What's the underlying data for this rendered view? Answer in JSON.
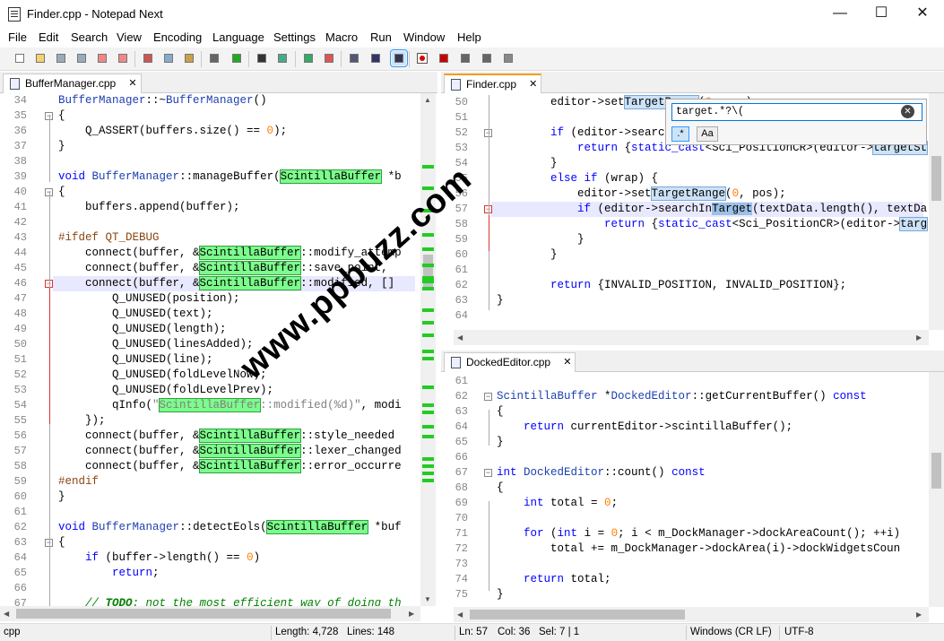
{
  "window": {
    "title": "Finder.cpp - Notepad Next",
    "minimize": "—",
    "maximize": "☐",
    "close": "✕"
  },
  "menu": [
    "File",
    "Edit",
    "Search",
    "View",
    "Encoding",
    "Language",
    "Settings",
    "Macro",
    "Run",
    "Window",
    "Help"
  ],
  "toolbar_icons": [
    "new-file-icon",
    "open-file-icon",
    "save-icon",
    "save-all-icon",
    "close-icon",
    "close-all-icon",
    "cut-icon",
    "copy-icon",
    "paste-icon",
    "undo-icon",
    "redo-icon",
    "find-icon",
    "replace-icon",
    "zoom-in-icon",
    "zoom-out-icon",
    "word-wrap-icon",
    "show-all-chars-icon",
    "indent-guide-icon",
    "record-macro-icon",
    "stop-record-icon",
    "play-macro-icon",
    "run-macro-multiple-icon",
    "save-macro-icon"
  ],
  "left_panel": {
    "tab": "BufferManager.cpp",
    "lines": [
      {
        "n": "34",
        "t": "<span class='ty'>BufferManager</span>::~<span class='ty'>BufferManager</span>()"
      },
      {
        "n": "35",
        "t": "{"
      },
      {
        "n": "36",
        "t": "    Q_ASSERT(buffers.size() == <span class='num'>0</span>);"
      },
      {
        "n": "37",
        "t": "}"
      },
      {
        "n": "38",
        "t": ""
      },
      {
        "n": "39",
        "t": "<span class='kw'>void</span> <span class='ty'>BufferManager</span>::manageBuffer(<span class='gh'>ScintillaBuffer</span> *b"
      },
      {
        "n": "40",
        "t": "{"
      },
      {
        "n": "41",
        "t": "    buffers.append(buffer);"
      },
      {
        "n": "42",
        "t": ""
      },
      {
        "n": "43",
        "t": "<span class='pp'>#ifdef QT_DEBUG</span>"
      },
      {
        "n": "44",
        "t": "    connect(buffer, &amp;<span class='gh'>ScintillaBuffer</span>::modify_attemp"
      },
      {
        "n": "45",
        "t": "    connect(buffer, &amp;<span class='gh'>ScintillaBuffer</span>::save_point,"
      },
      {
        "n": "46",
        "t": "    connect(buffer, &amp;<span class='gh'>ScintillaBuffer</span>::modified, []"
      },
      {
        "n": "47",
        "t": "        Q_UNUSED(position);"
      },
      {
        "n": "48",
        "t": "        Q_UNUSED(text);"
      },
      {
        "n": "49",
        "t": "        Q_UNUSED(length);"
      },
      {
        "n": "50",
        "t": "        Q_UNUSED(linesAdded);"
      },
      {
        "n": "51",
        "t": "        Q_UNUSED(line);"
      },
      {
        "n": "52",
        "t": "        Q_UNUSED(foldLevelNow);"
      },
      {
        "n": "53",
        "t": "        Q_UNUSED(foldLevelPrev);"
      },
      {
        "n": "54",
        "t": "        qInfo(<span class='str'>\"<span class='gh'>ScintillaBuffer</span>::modified(%d)\"</span>, modi"
      },
      {
        "n": "55",
        "t": "    });"
      },
      {
        "n": "56",
        "t": "    connect(buffer, &amp;<span class='gh'>ScintillaBuffer</span>::style_needed"
      },
      {
        "n": "57",
        "t": "    connect(buffer, &amp;<span class='gh'>ScintillaBuffer</span>::lexer_changed"
      },
      {
        "n": "58",
        "t": "    connect(buffer, &amp;<span class='gh'>ScintillaBuffer</span>::error_occurre"
      },
      {
        "n": "59",
        "t": "<span class='pp'>#endif</span>"
      },
      {
        "n": "60",
        "t": "}"
      },
      {
        "n": "61",
        "t": ""
      },
      {
        "n": "62",
        "t": "<span class='kw'>void</span> <span class='ty'>BufferManager</span>::detectEols(<span class='gh'>ScintillaBuffer</span> *buf"
      },
      {
        "n": "63",
        "t": "{"
      },
      {
        "n": "64",
        "t": "    <span class='kw'>if</span> (buffer->length() == <span class='num'>0</span>)"
      },
      {
        "n": "65",
        "t": "        <span class='kw'>return</span>;"
      },
      {
        "n": "66",
        "t": ""
      },
      {
        "n": "67",
        "t": "    <span class='cm'>// <b>TODO</b>: not the most efficient way of doing th</span>"
      }
    ]
  },
  "finder_panel": {
    "tab": "Finder.cpp",
    "lines": [
      {
        "n": "50",
        "t": "        editor->set<span class='bh'>TargetRange</span>(<span class='num'>0</span>, pos);"
      },
      {
        "n": "51",
        "t": ""
      },
      {
        "n": "52",
        "t": "        <span class='kw'>if</span> (editor->searchIn<span class='bh'>Target</span>(textData.length(), textDa"
      },
      {
        "n": "53",
        "t": "            <span class='kw'>return</span> {<span class='kw'>static_cast</span>&lt;Sci_PositionCR&gt;(editor-><span class='bh'>targetSt</span>"
      },
      {
        "n": "54",
        "t": "        }"
      },
      {
        "n": "55",
        "t": "        <span class='kw'>else if</span> (wrap) {"
      },
      {
        "n": "56",
        "t": "            editor->set<span class='bh'>TargetRange</span>(<span class='num'>0</span>, pos);"
      },
      {
        "n": "57",
        "t": "            <span class='kw'>if</span> (editor->searchIn<span class='bh2'>Target</span>(textData.length(), textDa"
      },
      {
        "n": "58",
        "t": "                <span class='kw'>return</span> {<span class='kw'>static_cast</span>&lt;Sci_PositionCR&gt;(editor-><span class='bh'>targ</span>"
      },
      {
        "n": "59",
        "t": "            }"
      },
      {
        "n": "60",
        "t": "        }"
      },
      {
        "n": "61",
        "t": ""
      },
      {
        "n": "62",
        "t": "        <span class='kw'>return</span> {INVALID_POSITION, INVALID_POSITION};"
      },
      {
        "n": "63",
        "t": "}"
      },
      {
        "n": "64",
        "t": ""
      }
    ]
  },
  "find_box": {
    "value": "target.*?\\(",
    "regex_label": ".*",
    "case_label": "Aa",
    "clear": "✕"
  },
  "docked_panel": {
    "tab": "DockedEditor.cpp",
    "lines": [
      {
        "n": "61",
        "t": ""
      },
      {
        "n": "62",
        "t": "<span class='ty'>ScintillaBuffer</span> *<span class='ty'>DockedEditor</span>::getCurrentBuffer() <span class='kw'>const</span>"
      },
      {
        "n": "63",
        "t": "{"
      },
      {
        "n": "64",
        "t": "    <span class='kw'>return</span> currentEditor->scintillaBuffer();"
      },
      {
        "n": "65",
        "t": "}"
      },
      {
        "n": "66",
        "t": ""
      },
      {
        "n": "67",
        "t": "<span class='kw'>int</span> <span class='ty'>DockedEditor</span>::count() <span class='kw'>const</span>"
      },
      {
        "n": "68",
        "t": "{"
      },
      {
        "n": "69",
        "t": "    <span class='kw'>int</span> total = <span class='num'>0</span>;"
      },
      {
        "n": "70",
        "t": ""
      },
      {
        "n": "71",
        "t": "    <span class='kw'>for</span> (<span class='kw'>int</span> i = <span class='num'>0</span>; i &lt; m_DockManager->dockAreaCount(); ++i)"
      },
      {
        "n": "72",
        "t": "        total += m_DockManager->dockArea(i)->dockWidgetsCoun"
      },
      {
        "n": "73",
        "t": ""
      },
      {
        "n": "74",
        "t": "    <span class='kw'>return</span> total;"
      },
      {
        "n": "75",
        "t": "}"
      }
    ]
  },
  "status": {
    "language": "cpp",
    "length": "Length: 4,728",
    "lines": "Lines: 148",
    "ln": "Ln: 57",
    "col": "Col: 36",
    "sel": "Sel: 7 | 1",
    "eol": "Windows (CR LF)",
    "encoding": "UTF-8"
  },
  "watermark": "www.ppbuzz.com",
  "tab_close": "✕"
}
